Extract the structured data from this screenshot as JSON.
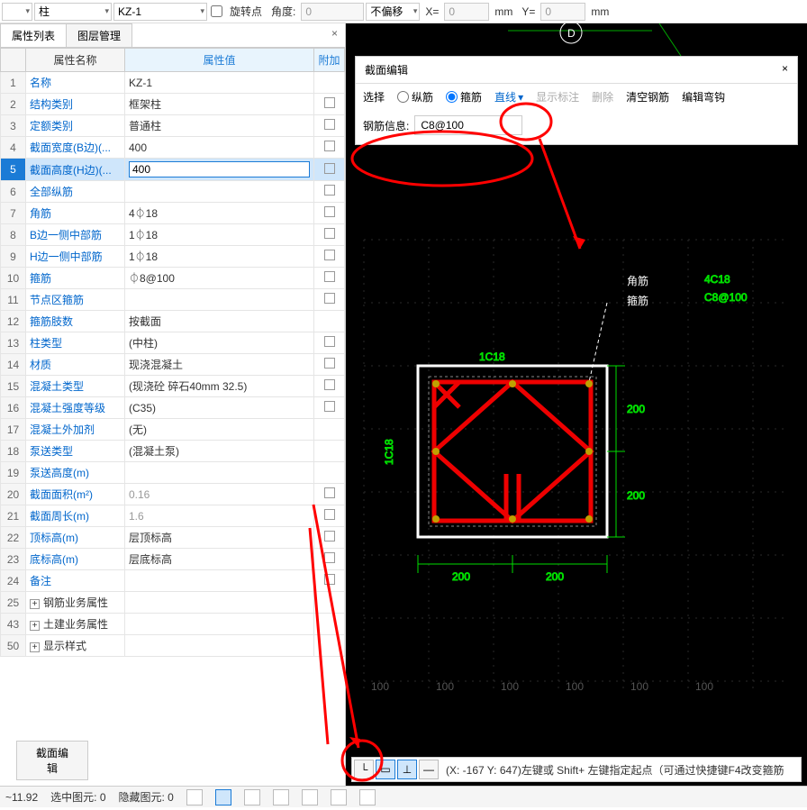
{
  "top": {
    "cat1": "",
    "cat2": "柱",
    "cat3": "KZ-1",
    "pivot_chk": false,
    "pivot_lbl": "旋转点",
    "angle_lbl": "角度:",
    "angle_val": "0",
    "offset_mode": "不偏移",
    "x_lbl": "X=",
    "x_val": "0",
    "x_unit": "mm",
    "y_lbl": "Y=",
    "y_val": "0",
    "y_unit": "mm"
  },
  "tabs": {
    "prop": "属性列表",
    "layer": "图层管理"
  },
  "table": {
    "h_name": "属性名称",
    "h_val": "属性值",
    "h_ext": "附加",
    "rows": [
      {
        "n": "1",
        "name": "名称",
        "val": "KZ-1",
        "link": true,
        "chk": ""
      },
      {
        "n": "2",
        "name": "结构类别",
        "val": "框架柱",
        "link": true,
        "chk": "y"
      },
      {
        "n": "3",
        "name": "定额类别",
        "val": "普通柱",
        "link": true,
        "chk": "y"
      },
      {
        "n": "4",
        "name": "截面宽度(B边)(...",
        "val": "400",
        "link": true,
        "chk": "y"
      },
      {
        "n": "5",
        "name": "截面高度(H边)(...",
        "val": "400",
        "link": true,
        "chk": "y",
        "sel": true
      },
      {
        "n": "6",
        "name": "全部纵筋",
        "val": "",
        "link": true,
        "chk": "y"
      },
      {
        "n": "7",
        "name": "角筋",
        "val": "4⏀18",
        "link": true,
        "chk": "y"
      },
      {
        "n": "8",
        "name": "B边一侧中部筋",
        "val": "1⏀18",
        "link": true,
        "chk": "y"
      },
      {
        "n": "9",
        "name": "H边一侧中部筋",
        "val": "1⏀18",
        "link": true,
        "chk": "y"
      },
      {
        "n": "10",
        "name": "箍筋",
        "val": "⏀8@100",
        "link": true,
        "chk": "y"
      },
      {
        "n": "11",
        "name": "节点区箍筋",
        "val": "",
        "link": true,
        "chk": "y"
      },
      {
        "n": "12",
        "name": "箍筋肢数",
        "val": "按截面",
        "link": true,
        "chk": ""
      },
      {
        "n": "13",
        "name": "柱类型",
        "val": "(中柱)",
        "link": true,
        "chk": "y"
      },
      {
        "n": "14",
        "name": "材质",
        "val": "现浇混凝土",
        "link": true,
        "chk": "y"
      },
      {
        "n": "15",
        "name": "混凝土类型",
        "val": "(现浇砼 碎石40mm 32.5)",
        "link": true,
        "chk": "y"
      },
      {
        "n": "16",
        "name": "混凝土强度等级",
        "val": "(C35)",
        "link": true,
        "chk": "y"
      },
      {
        "n": "17",
        "name": "混凝土外加剂",
        "val": "(无)",
        "link": true,
        "chk": ""
      },
      {
        "n": "18",
        "name": "泵送类型",
        "val": "(混凝土泵)",
        "link": true,
        "chk": ""
      },
      {
        "n": "19",
        "name": "泵送高度(m)",
        "val": "",
        "link": true,
        "chk": ""
      },
      {
        "n": "20",
        "name": "截面面积(m²)",
        "val": "0.16",
        "link": true,
        "chk": "y",
        "gray": true
      },
      {
        "n": "21",
        "name": "截面周长(m)",
        "val": "1.6",
        "link": true,
        "chk": "y",
        "gray": true
      },
      {
        "n": "22",
        "name": "顶标高(m)",
        "val": "层顶标高",
        "link": true,
        "chk": "y"
      },
      {
        "n": "23",
        "name": "底标高(m)",
        "val": "层底标高",
        "link": true,
        "chk": "y"
      },
      {
        "n": "24",
        "name": "备注",
        "val": "",
        "link": true,
        "chk": "y"
      },
      {
        "n": "25",
        "name": "钢筋业务属性",
        "val": "",
        "link": false,
        "exp": true
      },
      {
        "n": "43",
        "name": "土建业务属性",
        "val": "",
        "link": false,
        "exp": true
      },
      {
        "n": "50",
        "name": "显示样式",
        "val": "",
        "link": false,
        "exp": true
      }
    ]
  },
  "section_btn": "截面编辑",
  "editor": {
    "title": "截面编辑",
    "select": "选择",
    "r_long": "纵筋",
    "r_stir": "箍筋",
    "line": "直线",
    "show_dim": "显示标注",
    "delete": "删除",
    "clear": "清空钢筋",
    "edit_hook": "编辑弯钩",
    "steel_lbl": "钢筋信息:",
    "steel_val": "C8@100"
  },
  "canvas": {
    "grid_mark": "D",
    "lbl_corner": "角筋",
    "lbl_stirrup": "箍筋",
    "lbl_4c18": "4C18",
    "lbl_c8100": "C8@100",
    "lbl_1c18_top": "1C18",
    "lbl_1c18_left": "1C18",
    "dim_200": "200",
    "axis_100": "100"
  },
  "draw": {
    "hint": "(X: -167 Y: 647)左键或 Shift+ 左键指定起点（可通过快捷键F4改变箍筋"
  },
  "status": {
    "zoom": "~11.92",
    "sel": "选中图元: 0",
    "hid": "隐藏图元: 0"
  }
}
